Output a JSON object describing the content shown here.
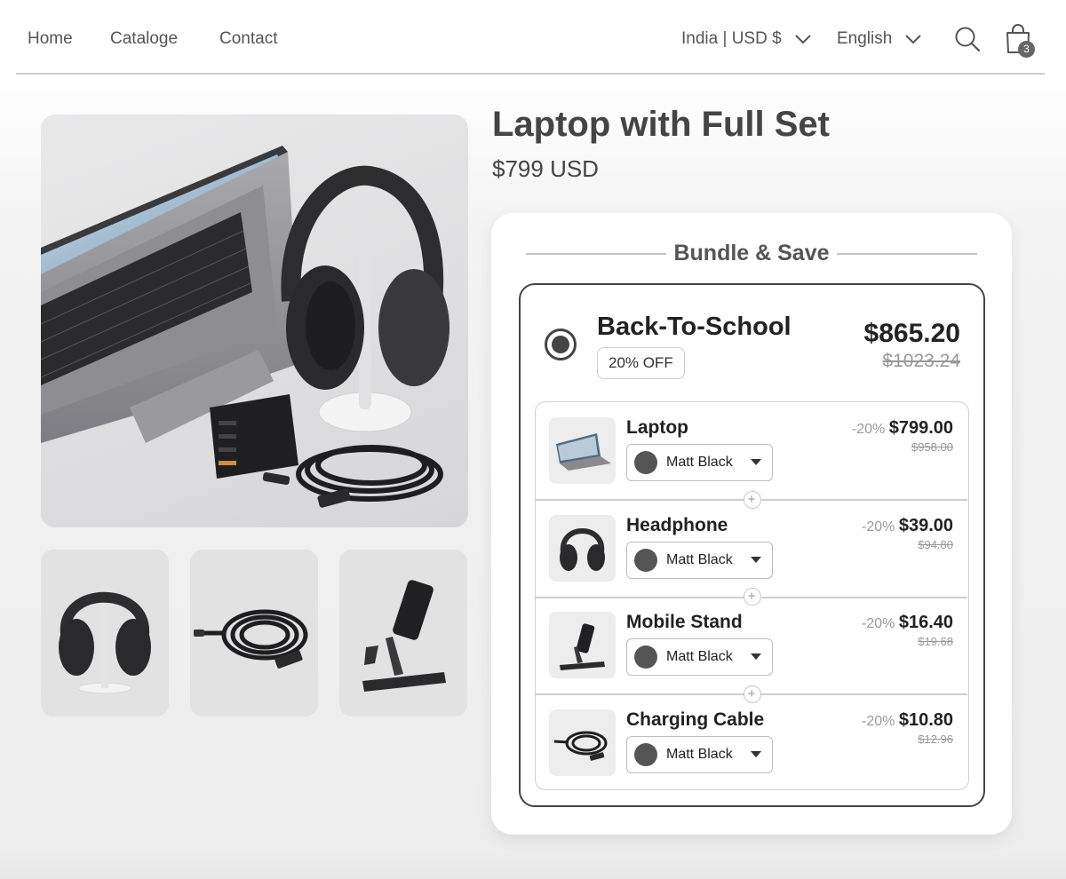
{
  "header": {
    "nav": [
      "Home",
      "Cataloge",
      "Contact"
    ],
    "region": "India | USD $",
    "language": "English",
    "cart_count": "3"
  },
  "product": {
    "title": "Laptop with Full Set",
    "price": "$799 USD"
  },
  "bundle": {
    "heading": "Bundle & Save",
    "offer": {
      "name": "Back-To-School",
      "badge": "20% OFF",
      "price": "$865.20",
      "compare_price": "$1023.24",
      "selected": true
    },
    "items": [
      {
        "name": "Laptop",
        "variant": "Matt Black",
        "discount": "-20%",
        "price": "$799.00",
        "compare_price": "$958.00"
      },
      {
        "name": "Headphone",
        "variant": "Matt Black",
        "discount": "-20%",
        "price": "$39.00",
        "compare_price": "$94.80"
      },
      {
        "name": "Mobile Stand",
        "variant": "Matt Black",
        "discount": "-20%",
        "price": "$16.40",
        "compare_price": "$19.68"
      },
      {
        "name": "Charging Cable",
        "variant": "Matt Black",
        "discount": "-20%",
        "price": "$10.80",
        "compare_price": "$12.96"
      }
    ]
  },
  "colors": {
    "accent": "#444444",
    "swatch_matt_black": "#555555"
  }
}
